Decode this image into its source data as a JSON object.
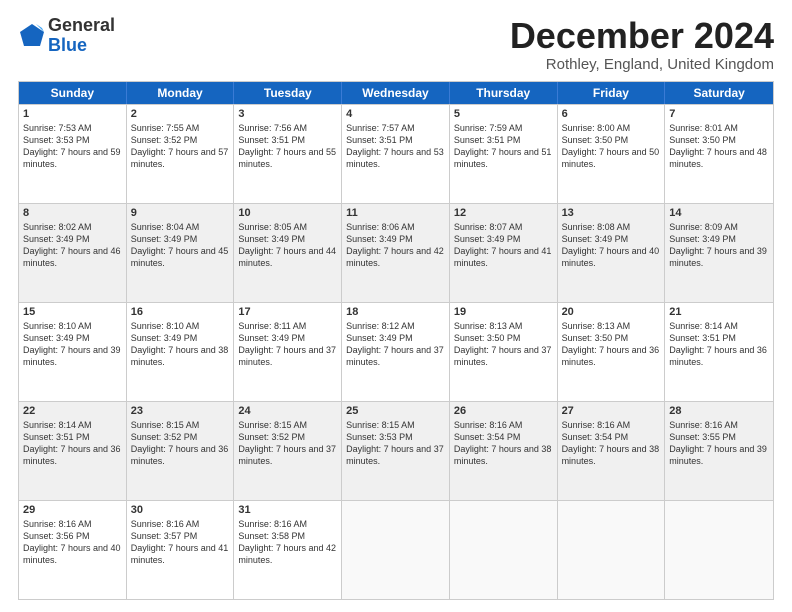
{
  "logo": {
    "general": "General",
    "blue": "Blue"
  },
  "title": "December 2024",
  "subtitle": "Rothley, England, United Kingdom",
  "header_days": [
    "Sunday",
    "Monday",
    "Tuesday",
    "Wednesday",
    "Thursday",
    "Friday",
    "Saturday"
  ],
  "weeks": [
    [
      {
        "day": "1",
        "rise": "Sunrise: 7:53 AM",
        "set": "Sunset: 3:53 PM",
        "daylight": "Daylight: 7 hours and 59 minutes.",
        "shaded": false,
        "empty": false
      },
      {
        "day": "2",
        "rise": "Sunrise: 7:55 AM",
        "set": "Sunset: 3:52 PM",
        "daylight": "Daylight: 7 hours and 57 minutes.",
        "shaded": false,
        "empty": false
      },
      {
        "day": "3",
        "rise": "Sunrise: 7:56 AM",
        "set": "Sunset: 3:51 PM",
        "daylight": "Daylight: 7 hours and 55 minutes.",
        "shaded": false,
        "empty": false
      },
      {
        "day": "4",
        "rise": "Sunrise: 7:57 AM",
        "set": "Sunset: 3:51 PM",
        "daylight": "Daylight: 7 hours and 53 minutes.",
        "shaded": false,
        "empty": false
      },
      {
        "day": "5",
        "rise": "Sunrise: 7:59 AM",
        "set": "Sunset: 3:51 PM",
        "daylight": "Daylight: 7 hours and 51 minutes.",
        "shaded": false,
        "empty": false
      },
      {
        "day": "6",
        "rise": "Sunrise: 8:00 AM",
        "set": "Sunset: 3:50 PM",
        "daylight": "Daylight: 7 hours and 50 minutes.",
        "shaded": false,
        "empty": false
      },
      {
        "day": "7",
        "rise": "Sunrise: 8:01 AM",
        "set": "Sunset: 3:50 PM",
        "daylight": "Daylight: 7 hours and 48 minutes.",
        "shaded": false,
        "empty": false
      }
    ],
    [
      {
        "day": "8",
        "rise": "Sunrise: 8:02 AM",
        "set": "Sunset: 3:49 PM",
        "daylight": "Daylight: 7 hours and 46 minutes.",
        "shaded": true,
        "empty": false
      },
      {
        "day": "9",
        "rise": "Sunrise: 8:04 AM",
        "set": "Sunset: 3:49 PM",
        "daylight": "Daylight: 7 hours and 45 minutes.",
        "shaded": true,
        "empty": false
      },
      {
        "day": "10",
        "rise": "Sunrise: 8:05 AM",
        "set": "Sunset: 3:49 PM",
        "daylight": "Daylight: 7 hours and 44 minutes.",
        "shaded": true,
        "empty": false
      },
      {
        "day": "11",
        "rise": "Sunrise: 8:06 AM",
        "set": "Sunset: 3:49 PM",
        "daylight": "Daylight: 7 hours and 42 minutes.",
        "shaded": true,
        "empty": false
      },
      {
        "day": "12",
        "rise": "Sunrise: 8:07 AM",
        "set": "Sunset: 3:49 PM",
        "daylight": "Daylight: 7 hours and 41 minutes.",
        "shaded": true,
        "empty": false
      },
      {
        "day": "13",
        "rise": "Sunrise: 8:08 AM",
        "set": "Sunset: 3:49 PM",
        "daylight": "Daylight: 7 hours and 40 minutes.",
        "shaded": true,
        "empty": false
      },
      {
        "day": "14",
        "rise": "Sunrise: 8:09 AM",
        "set": "Sunset: 3:49 PM",
        "daylight": "Daylight: 7 hours and 39 minutes.",
        "shaded": true,
        "empty": false
      }
    ],
    [
      {
        "day": "15",
        "rise": "Sunrise: 8:10 AM",
        "set": "Sunset: 3:49 PM",
        "daylight": "Daylight: 7 hours and 39 minutes.",
        "shaded": false,
        "empty": false
      },
      {
        "day": "16",
        "rise": "Sunrise: 8:10 AM",
        "set": "Sunset: 3:49 PM",
        "daylight": "Daylight: 7 hours and 38 minutes.",
        "shaded": false,
        "empty": false
      },
      {
        "day": "17",
        "rise": "Sunrise: 8:11 AM",
        "set": "Sunset: 3:49 PM",
        "daylight": "Daylight: 7 hours and 37 minutes.",
        "shaded": false,
        "empty": false
      },
      {
        "day": "18",
        "rise": "Sunrise: 8:12 AM",
        "set": "Sunset: 3:49 PM",
        "daylight": "Daylight: 7 hours and 37 minutes.",
        "shaded": false,
        "empty": false
      },
      {
        "day": "19",
        "rise": "Sunrise: 8:13 AM",
        "set": "Sunset: 3:50 PM",
        "daylight": "Daylight: 7 hours and 37 minutes.",
        "shaded": false,
        "empty": false
      },
      {
        "day": "20",
        "rise": "Sunrise: 8:13 AM",
        "set": "Sunset: 3:50 PM",
        "daylight": "Daylight: 7 hours and 36 minutes.",
        "shaded": false,
        "empty": false
      },
      {
        "day": "21",
        "rise": "Sunrise: 8:14 AM",
        "set": "Sunset: 3:51 PM",
        "daylight": "Daylight: 7 hours and 36 minutes.",
        "shaded": false,
        "empty": false
      }
    ],
    [
      {
        "day": "22",
        "rise": "Sunrise: 8:14 AM",
        "set": "Sunset: 3:51 PM",
        "daylight": "Daylight: 7 hours and 36 minutes.",
        "shaded": true,
        "empty": false
      },
      {
        "day": "23",
        "rise": "Sunrise: 8:15 AM",
        "set": "Sunset: 3:52 PM",
        "daylight": "Daylight: 7 hours and 36 minutes.",
        "shaded": true,
        "empty": false
      },
      {
        "day": "24",
        "rise": "Sunrise: 8:15 AM",
        "set": "Sunset: 3:52 PM",
        "daylight": "Daylight: 7 hours and 37 minutes.",
        "shaded": true,
        "empty": false
      },
      {
        "day": "25",
        "rise": "Sunrise: 8:15 AM",
        "set": "Sunset: 3:53 PM",
        "daylight": "Daylight: 7 hours and 37 minutes.",
        "shaded": true,
        "empty": false
      },
      {
        "day": "26",
        "rise": "Sunrise: 8:16 AM",
        "set": "Sunset: 3:54 PM",
        "daylight": "Daylight: 7 hours and 38 minutes.",
        "shaded": true,
        "empty": false
      },
      {
        "day": "27",
        "rise": "Sunrise: 8:16 AM",
        "set": "Sunset: 3:54 PM",
        "daylight": "Daylight: 7 hours and 38 minutes.",
        "shaded": true,
        "empty": false
      },
      {
        "day": "28",
        "rise": "Sunrise: 8:16 AM",
        "set": "Sunset: 3:55 PM",
        "daylight": "Daylight: 7 hours and 39 minutes.",
        "shaded": true,
        "empty": false
      }
    ],
    [
      {
        "day": "29",
        "rise": "Sunrise: 8:16 AM",
        "set": "Sunset: 3:56 PM",
        "daylight": "Daylight: 7 hours and 40 minutes.",
        "shaded": false,
        "empty": false
      },
      {
        "day": "30",
        "rise": "Sunrise: 8:16 AM",
        "set": "Sunset: 3:57 PM",
        "daylight": "Daylight: 7 hours and 41 minutes.",
        "shaded": false,
        "empty": false
      },
      {
        "day": "31",
        "rise": "Sunrise: 8:16 AM",
        "set": "Sunset: 3:58 PM",
        "daylight": "Daylight: 7 hours and 42 minutes.",
        "shaded": false,
        "empty": false
      },
      {
        "day": "",
        "rise": "",
        "set": "",
        "daylight": "",
        "shaded": false,
        "empty": true
      },
      {
        "day": "",
        "rise": "",
        "set": "",
        "daylight": "",
        "shaded": false,
        "empty": true
      },
      {
        "day": "",
        "rise": "",
        "set": "",
        "daylight": "",
        "shaded": false,
        "empty": true
      },
      {
        "day": "",
        "rise": "",
        "set": "",
        "daylight": "",
        "shaded": false,
        "empty": true
      }
    ]
  ]
}
